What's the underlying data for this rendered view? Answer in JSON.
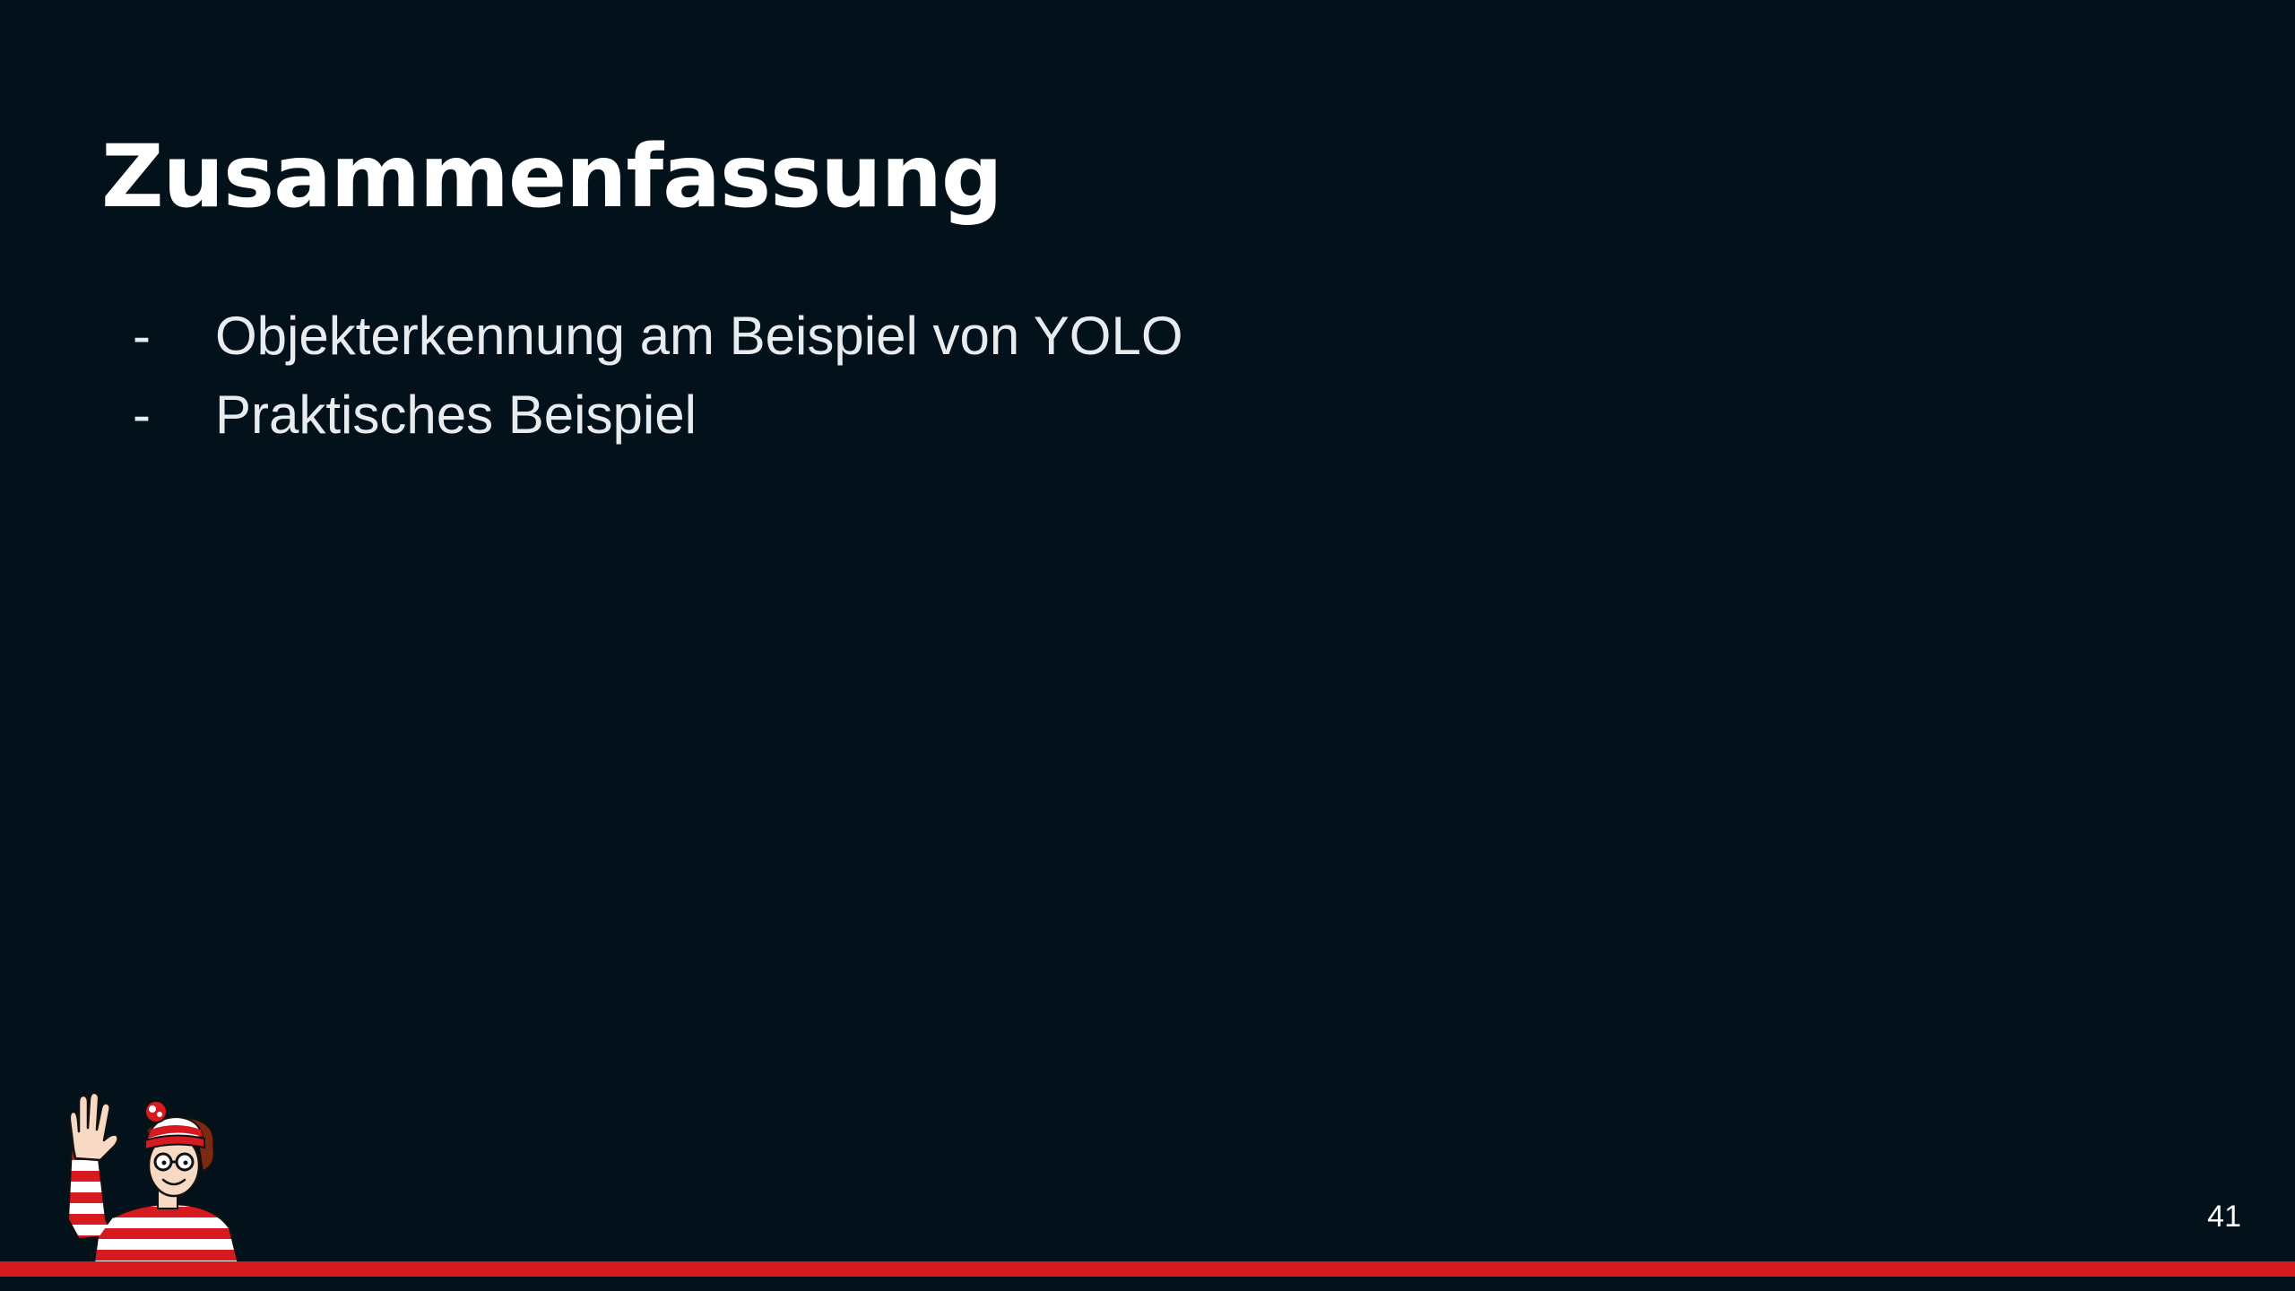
{
  "slide": {
    "title": "Zusammenfassung",
    "bullets": [
      {
        "marker": "-",
        "text": "Objekterkennung am Beispiel von YOLO"
      },
      {
        "marker": "-",
        "text": "Praktisches Beispiel"
      }
    ],
    "page_number": "41"
  },
  "colors": {
    "background": "#02111a",
    "accent": "#d71920",
    "title": "#ffffff",
    "body_text": "#e9ecef"
  },
  "illustration": {
    "icon": "waving-waldo-icon"
  }
}
